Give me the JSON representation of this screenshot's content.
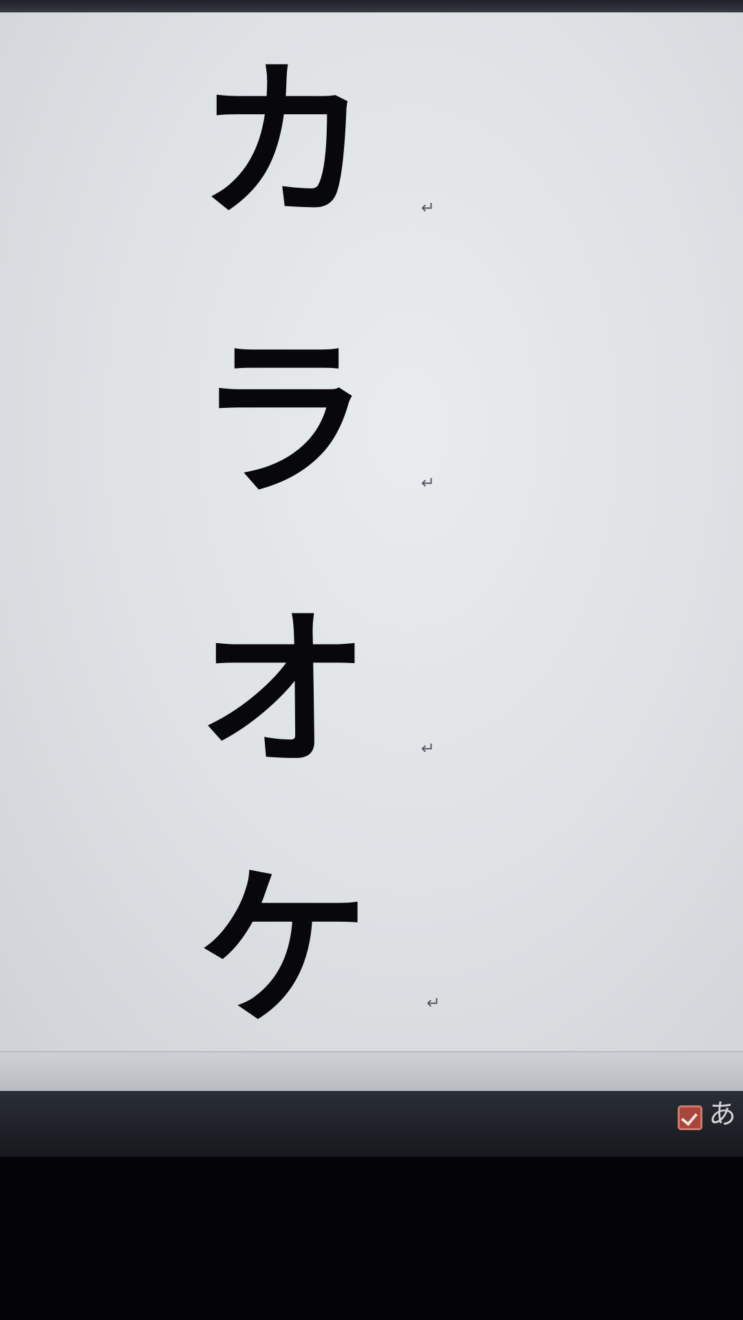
{
  "document": {
    "lines": [
      {
        "char": "カ",
        "mark": "↵"
      },
      {
        "char": "ラ",
        "mark": "↵"
      },
      {
        "char": "オ",
        "mark": "↵"
      },
      {
        "char": "ケ",
        "mark": "↵"
      }
    ]
  },
  "taskbar": {
    "ime_icon": "checkmark-pen-icon",
    "ime_mode": "あ"
  }
}
